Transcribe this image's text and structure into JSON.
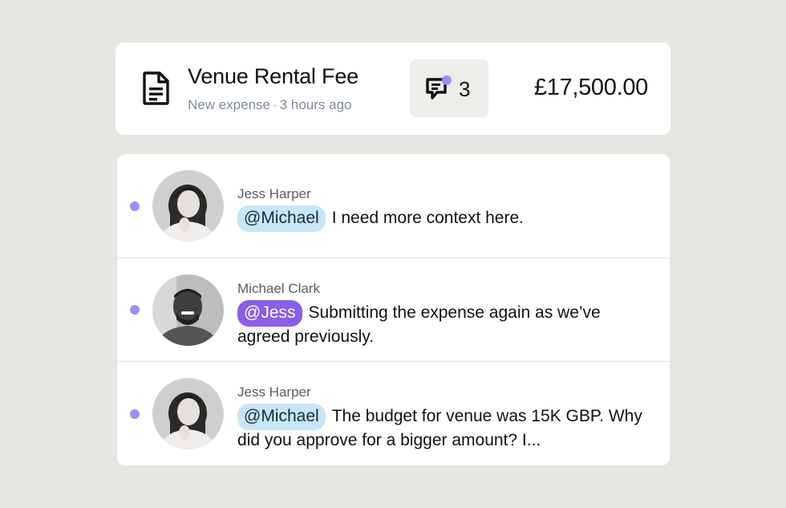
{
  "expense": {
    "title": "Venue Rental Fee",
    "status": "New expense",
    "separator": "·",
    "time_ago": "3 hours ago",
    "comment_count": "3",
    "amount": "£17,500.00",
    "icon": "document-icon",
    "comment_icon": "comment-icon"
  },
  "colors": {
    "unread_dot": "#a28bf2",
    "mention_blue": "#c7e6f8",
    "mention_purple": "#8a5ee6",
    "background": "#e8e6e3"
  },
  "comments": [
    {
      "author": "Jess Harper",
      "mention": "@Michael",
      "text": "I need more context here.",
      "unread": true
    },
    {
      "author": "Michael Clark",
      "mention": "@Jess",
      "text": "Submitting the expense again as we’ve agreed previously.",
      "unread": true
    },
    {
      "author": "Jess Harper",
      "mention": "@Michael",
      "text": "The budget for venue was 15K GBP. Why did you approve for a bigger amount? I...",
      "unread": true
    }
  ]
}
